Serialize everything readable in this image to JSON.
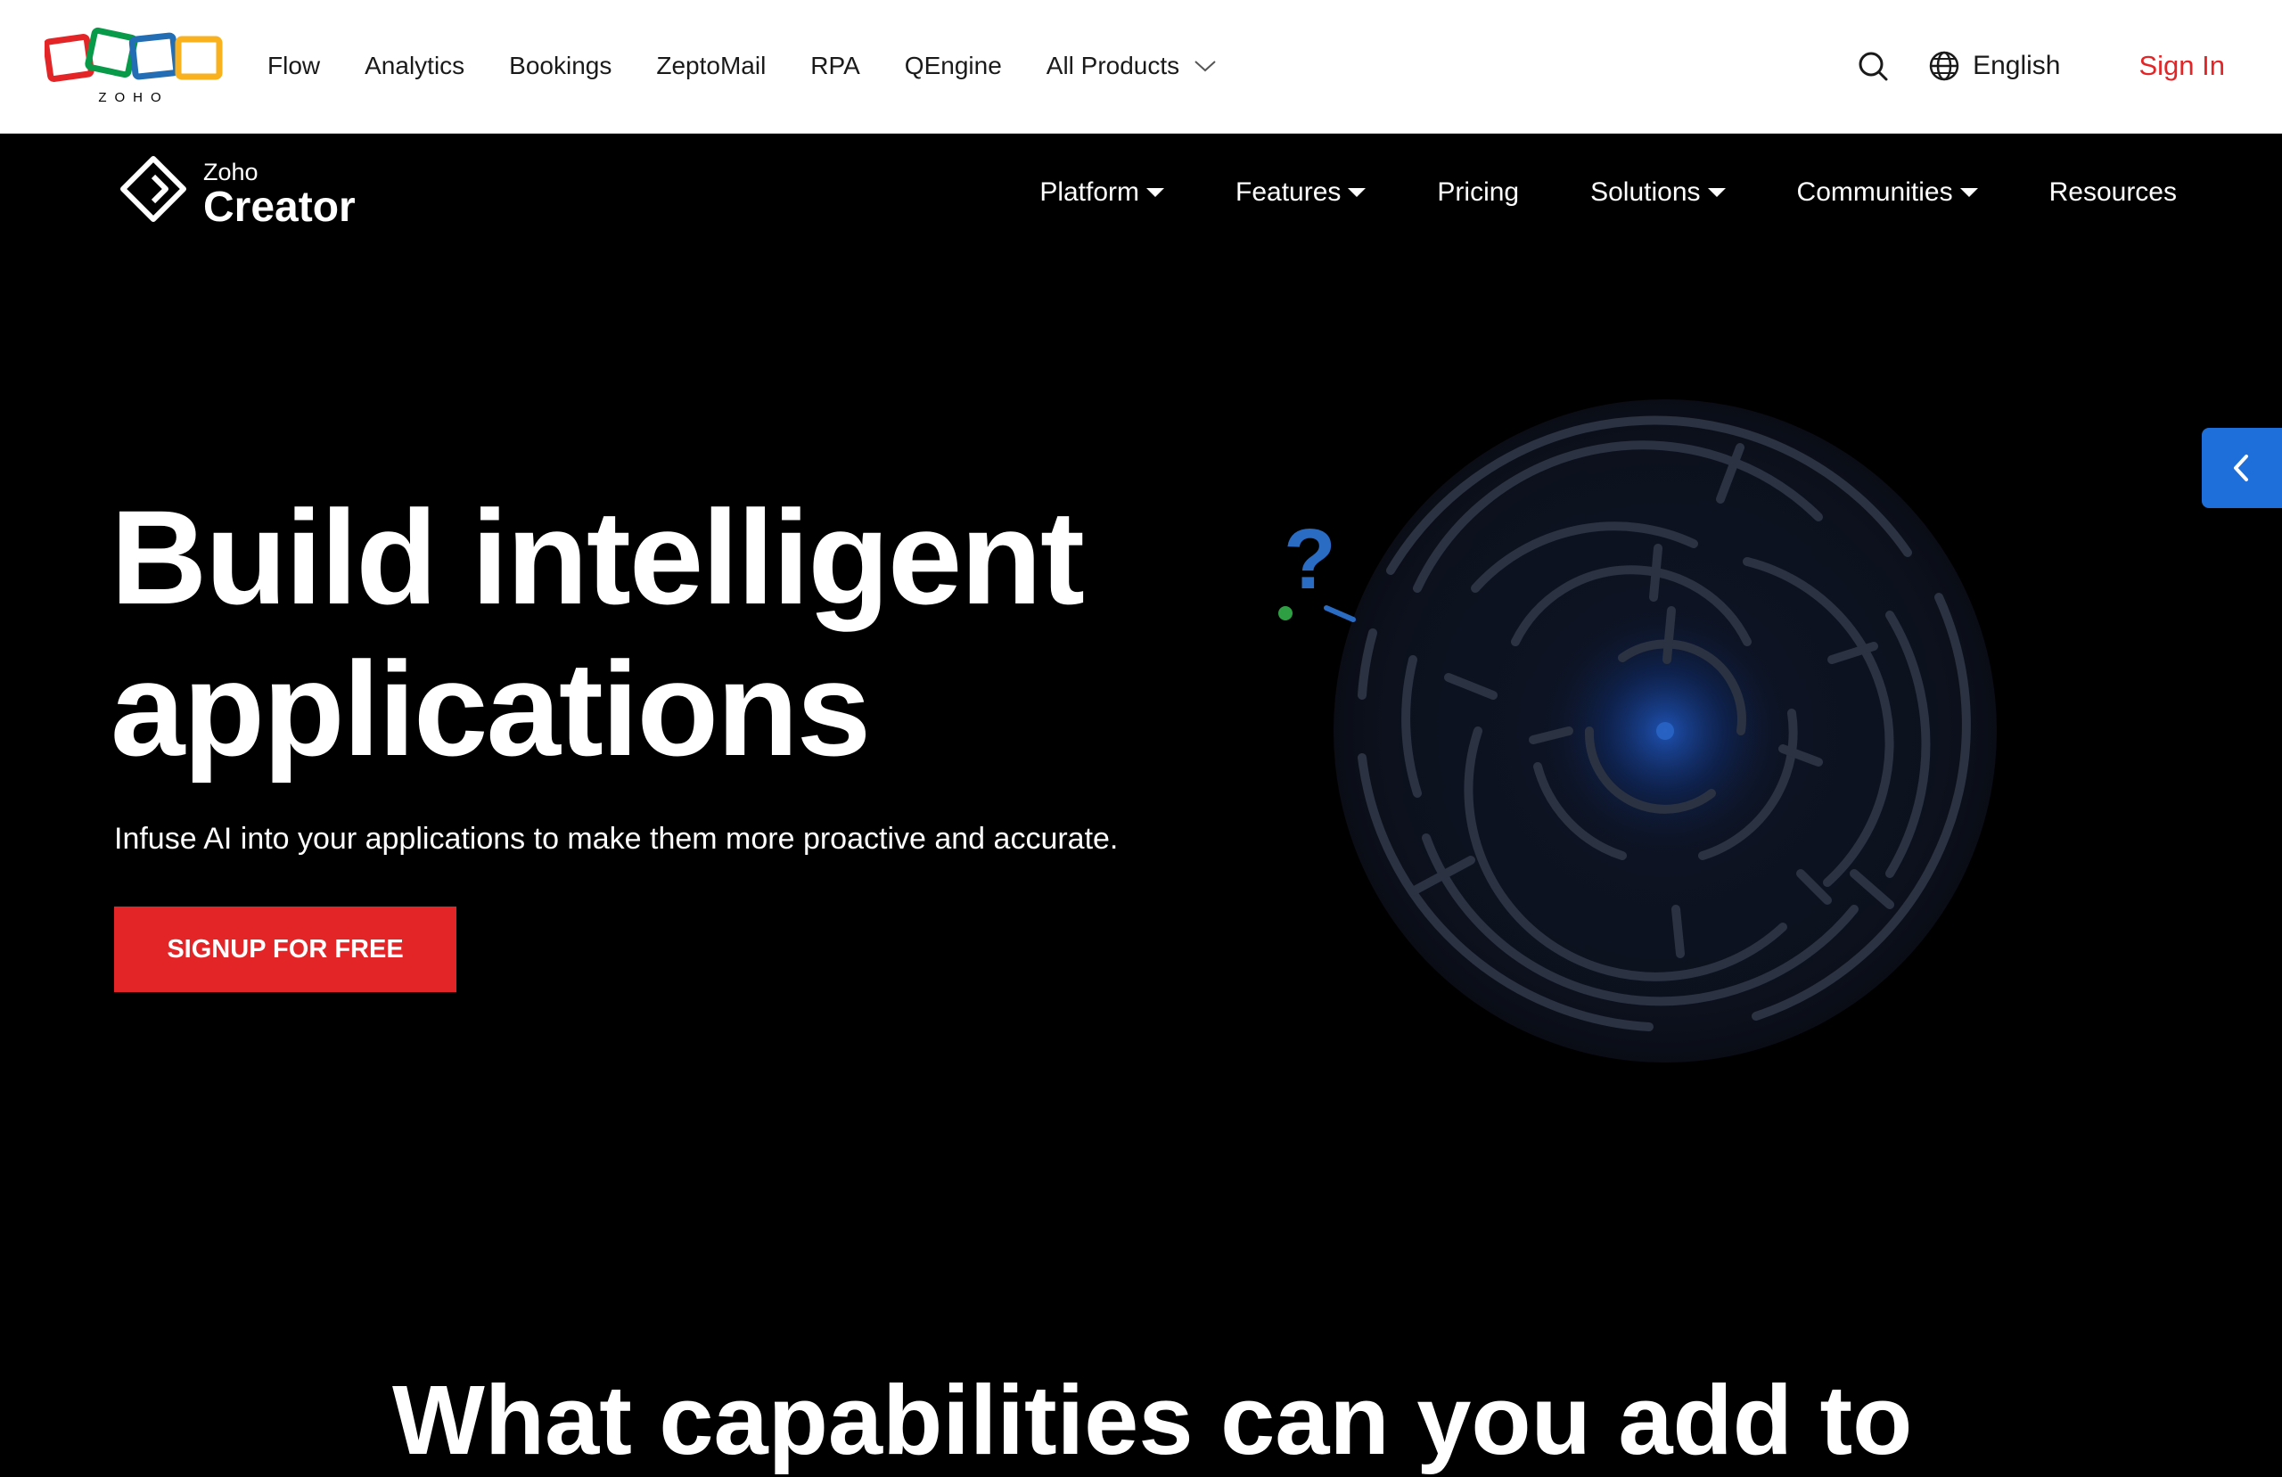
{
  "top_nav": {
    "logo_text": "ZOHO",
    "items": [
      {
        "label": "Flow"
      },
      {
        "label": "Analytics"
      },
      {
        "label": "Bookings"
      },
      {
        "label": "ZeptoMail"
      },
      {
        "label": "RPA"
      },
      {
        "label": "QEngine"
      }
    ],
    "all_products": "All Products",
    "language": "English",
    "sign_in": "Sign In"
  },
  "product_nav": {
    "brand_small": "Zoho",
    "brand_name": "Creator",
    "items": [
      {
        "label": "Platform",
        "has_dropdown": true
      },
      {
        "label": "Features",
        "has_dropdown": true
      },
      {
        "label": "Pricing",
        "has_dropdown": false
      },
      {
        "label": "Solutions",
        "has_dropdown": true
      },
      {
        "label": "Communities",
        "has_dropdown": true
      },
      {
        "label": "Resources",
        "has_dropdown": false
      }
    ]
  },
  "hero": {
    "title_line1": "Build intelligent",
    "title_line2": "applications",
    "subtitle": "Infuse AI into your applications to make them more proactive and accurate.",
    "cta_label": "SIGNUP FOR FREE",
    "question_mark": "?"
  },
  "next_section": {
    "heading": "What capabilities can you add to"
  },
  "colors": {
    "brand_red": "#e42527",
    "accent_blue": "#1e6fd9",
    "zoho_red": "#e42527",
    "zoho_green": "#089949",
    "zoho_blue": "#226db4",
    "zoho_yellow": "#f9b21d"
  },
  "icons": {
    "search": "search-icon",
    "language": "globe-icon",
    "dropdown": "chevron-down-icon",
    "side_tab": "chevron-left-icon"
  }
}
